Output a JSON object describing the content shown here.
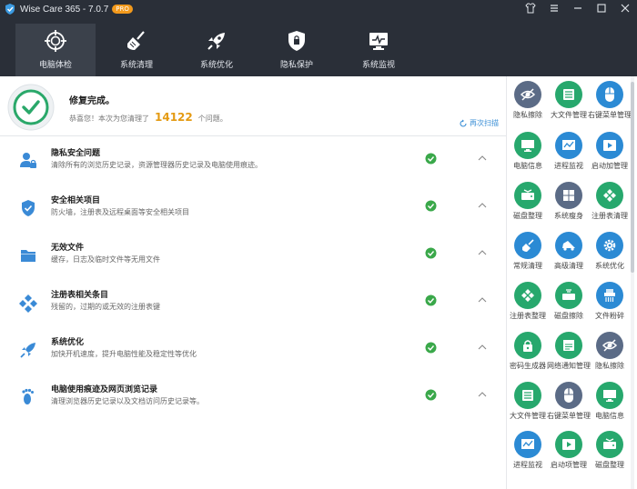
{
  "window": {
    "title": "Wise Care 365 - 7.0.7",
    "badge": "PRO"
  },
  "nav": {
    "tabs": [
      {
        "label": "电脑体检",
        "icon": "target-icon",
        "active": true
      },
      {
        "label": "系统清理",
        "icon": "broom-icon",
        "active": false
      },
      {
        "label": "系统优化",
        "icon": "rocket-icon",
        "active": false
      },
      {
        "label": "隐私保护",
        "icon": "shield-lock-icon",
        "active": false
      },
      {
        "label": "系统监视",
        "icon": "monitor-icon",
        "active": false
      }
    ]
  },
  "summary": {
    "title": "修复完成。",
    "prefix": "恭喜您！本次为您清理了",
    "count": "14122",
    "suffix": "个问题。",
    "recheck": "再次扫描"
  },
  "results": [
    {
      "title": "隐私安全问题",
      "desc": "清除所有的浏览历史记录，资源管理器历史记录及电脑使用痕迹。",
      "icon": "user-lock-icon"
    },
    {
      "title": "安全相关项目",
      "desc": "防火墙，注册表及远程桌面等安全相关项目",
      "icon": "shield-check-icon"
    },
    {
      "title": "无效文件",
      "desc": "缓存，日志及临时文件等无用文件",
      "icon": "folder-icon"
    },
    {
      "title": "注册表相关条目",
      "desc": "残留的，过期的或无效的注册表键",
      "icon": "registry-icon"
    },
    {
      "title": "系统优化",
      "desc": "加快开机速度，提升电脑性能及稳定性等优化",
      "icon": "rocket-small-icon"
    },
    {
      "title": "电脑使用痕迹及网页浏览记录",
      "desc": "清理浏览器历史记录以及文档访问历史记录等。",
      "icon": "footprint-icon"
    }
  ],
  "tools": [
    {
      "label": "隐私擦除",
      "icon": "eye-slash-icon",
      "color": "#5b6b86"
    },
    {
      "label": "大文件管理",
      "icon": "list-icon",
      "color": "#27a86d"
    },
    {
      "label": "右键菜单管理",
      "icon": "mouse-icon",
      "color": "#2b8ad4"
    },
    {
      "label": "电脑信息",
      "icon": "computer-icon",
      "color": "#27a86d"
    },
    {
      "label": "进程监视",
      "icon": "chart-icon",
      "color": "#2b8ad4"
    },
    {
      "label": "启动加管理",
      "icon": "play-icon",
      "color": "#2b8ad4"
    },
    {
      "label": "磁盘整理",
      "icon": "disk-icon",
      "color": "#27a86d"
    },
    {
      "label": "系统瘦身",
      "icon": "windows-icon",
      "color": "#5b6b86"
    },
    {
      "label": "注册表清理",
      "icon": "registry-icon",
      "color": "#27a86d"
    },
    {
      "label": "常规清理",
      "icon": "broom-icon",
      "color": "#2b8ad4"
    },
    {
      "label": "高级清理",
      "icon": "car-icon",
      "color": "#2b8ad4"
    },
    {
      "label": "系统优化",
      "icon": "gear-icon",
      "color": "#2b8ad4"
    },
    {
      "label": "注册表整理",
      "icon": "registry-icon",
      "color": "#27a86d"
    },
    {
      "label": "磁盘擦除",
      "icon": "disk-erase-icon",
      "color": "#27a86d"
    },
    {
      "label": "文件粉碎",
      "icon": "shredder-icon",
      "color": "#2b8ad4"
    },
    {
      "label": "密码生成器",
      "icon": "password-icon",
      "color": "#27a86d"
    },
    {
      "label": "网络通知管理",
      "icon": "network-icon",
      "color": "#27a86d"
    },
    {
      "label": "隐私擦除",
      "icon": "eye-slash-icon",
      "color": "#5b6b86"
    },
    {
      "label": "大文件管理",
      "icon": "list-icon",
      "color": "#27a86d"
    },
    {
      "label": "右键菜单管理",
      "icon": "mouse-icon",
      "color": "#5b6b86"
    },
    {
      "label": "电脑信息",
      "icon": "computer-icon",
      "color": "#27a86d"
    },
    {
      "label": "进程监视",
      "icon": "chart-icon",
      "color": "#2b8ad4"
    },
    {
      "label": "启动项管理",
      "icon": "play-icon",
      "color": "#27a86d"
    },
    {
      "label": "磁盘整理",
      "icon": "disk-icon",
      "color": "#27a86d"
    }
  ],
  "colors": {
    "dark": "#2a2f38",
    "accent": "#e49a12",
    "ok": "#3aa84a",
    "blue": "#2b8ad4",
    "green": "#27a86d"
  }
}
